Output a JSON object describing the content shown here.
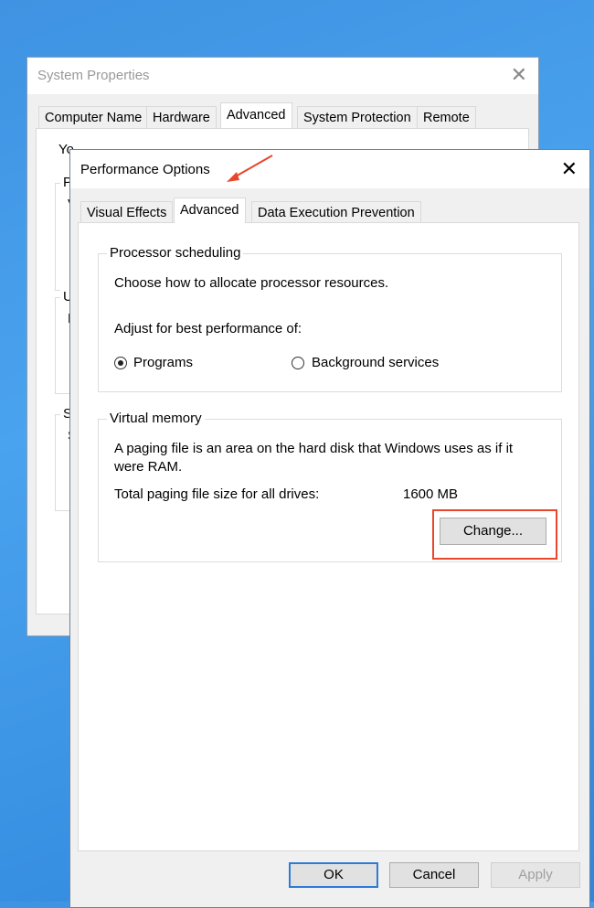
{
  "system_properties": {
    "title": "System Properties",
    "close_icon": "close-icon",
    "tabs": [
      {
        "label": "Computer Name"
      },
      {
        "label": "Hardware"
      },
      {
        "label": "Advanced",
        "selected": true
      },
      {
        "label": "System Protection"
      },
      {
        "label": "Remote"
      }
    ],
    "hidden_text_fragments": [
      "Yo",
      "P",
      "V",
      "U",
      "D",
      "S",
      "S"
    ]
  },
  "performance_options": {
    "title": "Performance Options",
    "close_icon": "close-icon",
    "tabs": [
      {
        "label": "Visual Effects"
      },
      {
        "label": "Advanced",
        "selected": true
      },
      {
        "label": "Data Execution Prevention"
      }
    ],
    "processor_scheduling": {
      "legend": "Processor scheduling",
      "description": "Choose how to allocate processor resources.",
      "adjust_label": "Adjust for best performance of:",
      "options": [
        {
          "label": "Programs",
          "checked": true
        },
        {
          "label": "Background services",
          "checked": false
        }
      ]
    },
    "virtual_memory": {
      "legend": "Virtual memory",
      "description_line1": "A paging file is an area on the hard disk that Windows uses as if it",
      "description_line2": "were RAM.",
      "total_label": "Total paging file size for all drives:",
      "total_value": "1600 MB",
      "change_button": "Change..."
    },
    "buttons": {
      "ok": "OK",
      "cancel": "Cancel",
      "apply": "Apply",
      "apply_disabled": true
    }
  },
  "annotation_color": "#e8472c"
}
